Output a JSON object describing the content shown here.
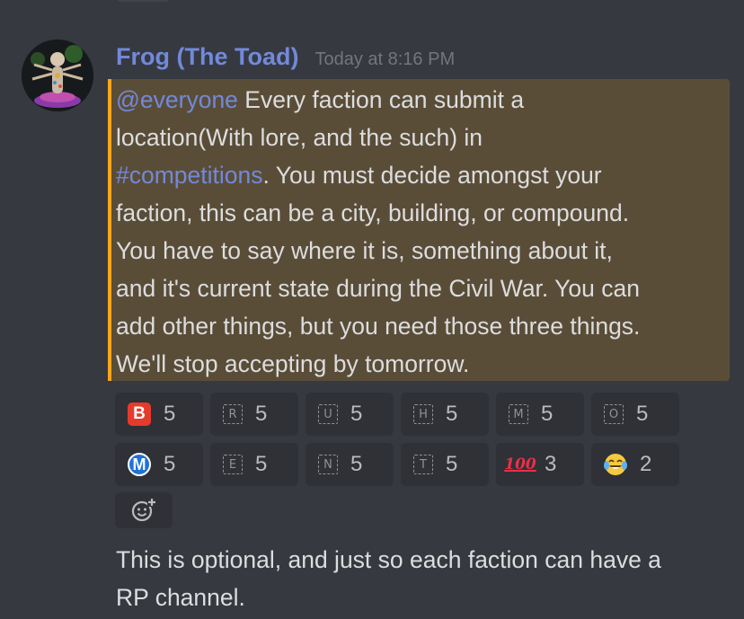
{
  "message": {
    "author": "Frog (The Toad)",
    "timestamp": "Today at 8:16 PM",
    "mention": "@everyone",
    "channel": "#competitions",
    "lines": [
      " Every faction can submit a",
      "location(With lore, and the such) in",
      ". You must decide amongst your",
      "faction, this can be a city, building, or compound.",
      "You have to  say where it is, something about it,",
      "and it's current state during the Civil War. You can",
      "add other things, but you need those three things.",
      "We'll stop accepting by tomorrow."
    ]
  },
  "reactions": [
    {
      "emoji": "B",
      "icon": "b-button-icon",
      "count": "5"
    },
    {
      "emoji": "R",
      "icon": "regional-indicator-r-icon",
      "count": "5"
    },
    {
      "emoji": "U",
      "icon": "regional-indicator-u-icon",
      "count": "5"
    },
    {
      "emoji": "H",
      "icon": "regional-indicator-h-icon",
      "count": "5"
    },
    {
      "emoji": "M",
      "icon": "regional-indicator-m-icon",
      "count": "5"
    },
    {
      "emoji": "O",
      "icon": "regional-indicator-o-icon",
      "count": "5"
    },
    {
      "emoji": "M",
      "icon": "circled-m-icon",
      "count": "5"
    },
    {
      "emoji": "E",
      "icon": "regional-indicator-e-icon",
      "count": "5"
    },
    {
      "emoji": "N",
      "icon": "regional-indicator-n-icon",
      "count": "5"
    },
    {
      "emoji": "T",
      "icon": "regional-indicator-t-icon",
      "count": "5"
    },
    {
      "emoji": "100",
      "icon": "hundred-points-icon",
      "count": "3"
    },
    {
      "emoji": "😂",
      "icon": "tears-of-joy-icon",
      "count": "2"
    }
  ],
  "add_reaction": {
    "icon": "add-reaction-smiley-icon"
  },
  "followup": {
    "lines": [
      "This is optional, and just so each faction can have a",
      "RP channel."
    ]
  },
  "colors": {
    "background": "#36393f",
    "mention_highlight": "#5a4d38",
    "mention_bar": "#faa61a",
    "link": "#7289da",
    "reaction_bg": "#2f3136"
  }
}
